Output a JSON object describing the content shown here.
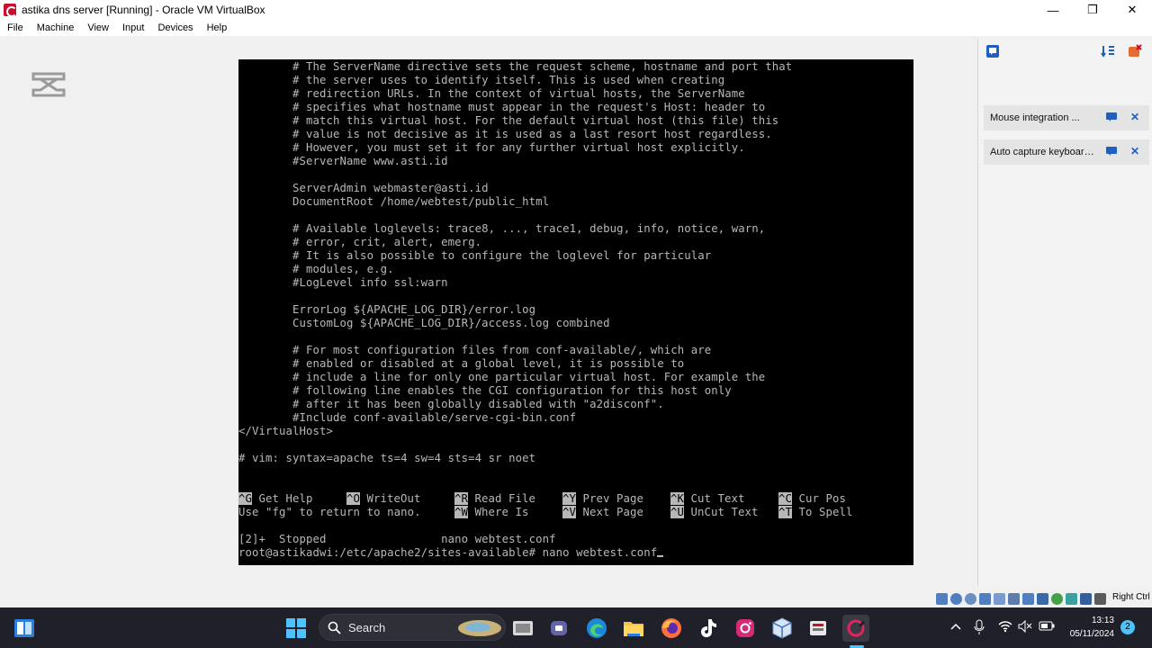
{
  "window": {
    "title": "astika dns server [Running] - Oracle VM VirtualBox",
    "controls": {
      "minimize": "—",
      "restore": "❐",
      "close": "✕"
    }
  },
  "menu": [
    "File",
    "Machine",
    "View",
    "Input",
    "Devices",
    "Help"
  ],
  "terminal": {
    "lines": [
      "        # The ServerName directive sets the request scheme, hostname and port that",
      "        # the server uses to identify itself. This is used when creating",
      "        # redirection URLs. In the context of virtual hosts, the ServerName",
      "        # specifies what hostname must appear in the request's Host: header to",
      "        # match this virtual host. For the default virtual host (this file) this",
      "        # value is not decisive as it is used as a last resort host regardless.",
      "        # However, you must set it for any further virtual host explicitly.",
      "        #ServerName www.asti.id",
      "",
      "        ServerAdmin webmaster@asti.id",
      "        DocumentRoot /home/webtest/public_html",
      "",
      "        # Available loglevels: trace8, ..., trace1, debug, info, notice, warn,",
      "        # error, crit, alert, emerg.",
      "        # It is also possible to configure the loglevel for particular",
      "        # modules, e.g.",
      "        #LogLevel info ssl:warn",
      "",
      "        ErrorLog ${APACHE_LOG_DIR}/error.log",
      "        CustomLog ${APACHE_LOG_DIR}/access.log combined",
      "",
      "        # For most configuration files from conf-available/, which are",
      "        # enabled or disabled at a global level, it is possible to",
      "        # include a line for only one particular virtual host. For example the",
      "        # following line enables the CGI configuration for this host only",
      "        # after it has been globally disabled with \"a2disconf\".",
      "        #Include conf-available/serve-cgi-bin.conf",
      "</VirtualHost>",
      "",
      "# vim: syntax=apache ts=4 sw=4 sts=4 sr noet"
    ],
    "shortcuts_row1": [
      {
        "key": "^G",
        "label": " Get Help"
      },
      {
        "key": "^O",
        "label": " WriteOut"
      },
      {
        "key": "^R",
        "label": " Read File"
      },
      {
        "key": "^Y",
        "label": " Prev Page"
      },
      {
        "key": "^K",
        "label": " Cut Text"
      },
      {
        "key": "^C",
        "label": " Cur Pos"
      }
    ],
    "shortcuts_row2_prefix": "Use \"fg\" to return to nano.",
    "shortcuts_row2": [
      {
        "key": "^W",
        "label": " Where Is"
      },
      {
        "key": "^V",
        "label": " Next Page"
      },
      {
        "key": "^U",
        "label": " UnCut Text"
      },
      {
        "key": "^T",
        "label": " To Spell"
      }
    ],
    "job_line": "[2]+  Stopped                 nano webtest.conf",
    "prompt_line": "root@astikadwi:/etc/apache2/sites-available# nano webtest.conf"
  },
  "notifications": [
    {
      "text": "Mouse integration ..."
    },
    {
      "text": "Auto capture keyboard ..."
    }
  ],
  "statusbar": {
    "host_key": "Right Ctrl"
  },
  "taskbar": {
    "search_label": "Search",
    "time": "13:13",
    "date": "05/11/2024",
    "notification_count": "2"
  },
  "colors": {
    "terminal_bg": "#000000",
    "terminal_fg": "#b8b8b8",
    "taskbar_bg": "#20202a",
    "accent": "#4cc2ff"
  }
}
